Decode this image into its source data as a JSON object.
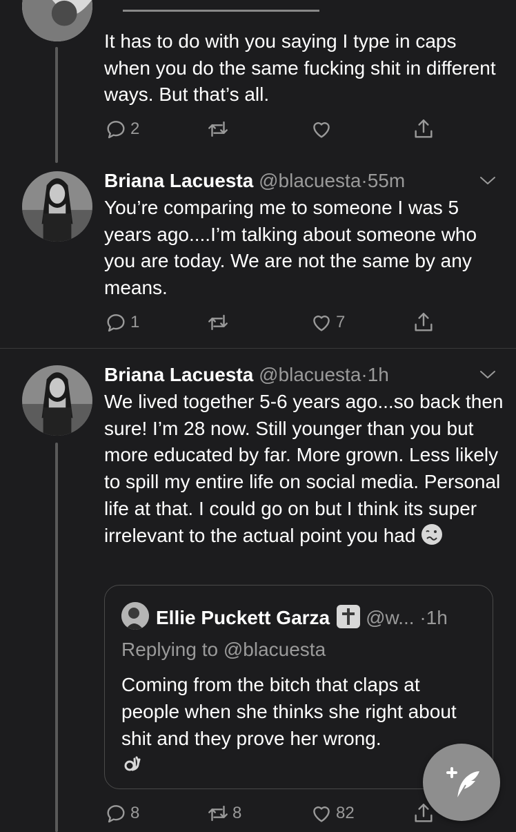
{
  "tweets": [
    {
      "body": "It has to do with you saying I type in caps when you do the same fucking shit in different ways. But that’s all.",
      "reply_count": "2",
      "retweet_count": "",
      "like_count": ""
    },
    {
      "name": "Briana Lacuesta",
      "handle": "@blacuesta",
      "separator": "·",
      "time": "55m",
      "body": "You’re comparing me to someone I was 5 years ago....I’m talking about someone who you are today. We are not the same by any means.",
      "reply_count": "1",
      "retweet_count": "",
      "like_count": "7"
    },
    {
      "name": "Briana Lacuesta",
      "handle": "@blacuesta",
      "separator": "·",
      "time": "1h",
      "body": "We lived together 5-6 years ago...so back then sure! I’m 28 now. Still younger than you but more educated by far. More grown. Less likely to spill my entire life on social media. Personal life at that. I could go on but I think its super irrelevant to the actual point you had",
      "trailing_emoji": "woozy-face",
      "reply_count": "8",
      "retweet_count": "8",
      "like_count": "82",
      "quote": {
        "name": "Ellie Puckett Garza",
        "badge": "latin-cross-emoji",
        "handle": "@w...",
        "separator": "·",
        "time": "1h",
        "replying": "Replying to @blacuesta",
        "body": "Coming from the bitch that claps at people when she thinks she right about shit and they prove her wrong.",
        "trailing_emoji": "ok-hand"
      }
    }
  ],
  "icons": {
    "reply": "reply-icon",
    "retweet": "retweet-icon",
    "like": "heart-icon",
    "share": "share-icon",
    "caret": "chevron-down-icon",
    "compose": "compose-tweet-icon"
  },
  "colors": {
    "background": "#1c1c1e",
    "text": "#ffffff",
    "secondary": "#9a9a9a",
    "divider": "#3a3a3a",
    "fab": "#8e8e8e"
  }
}
